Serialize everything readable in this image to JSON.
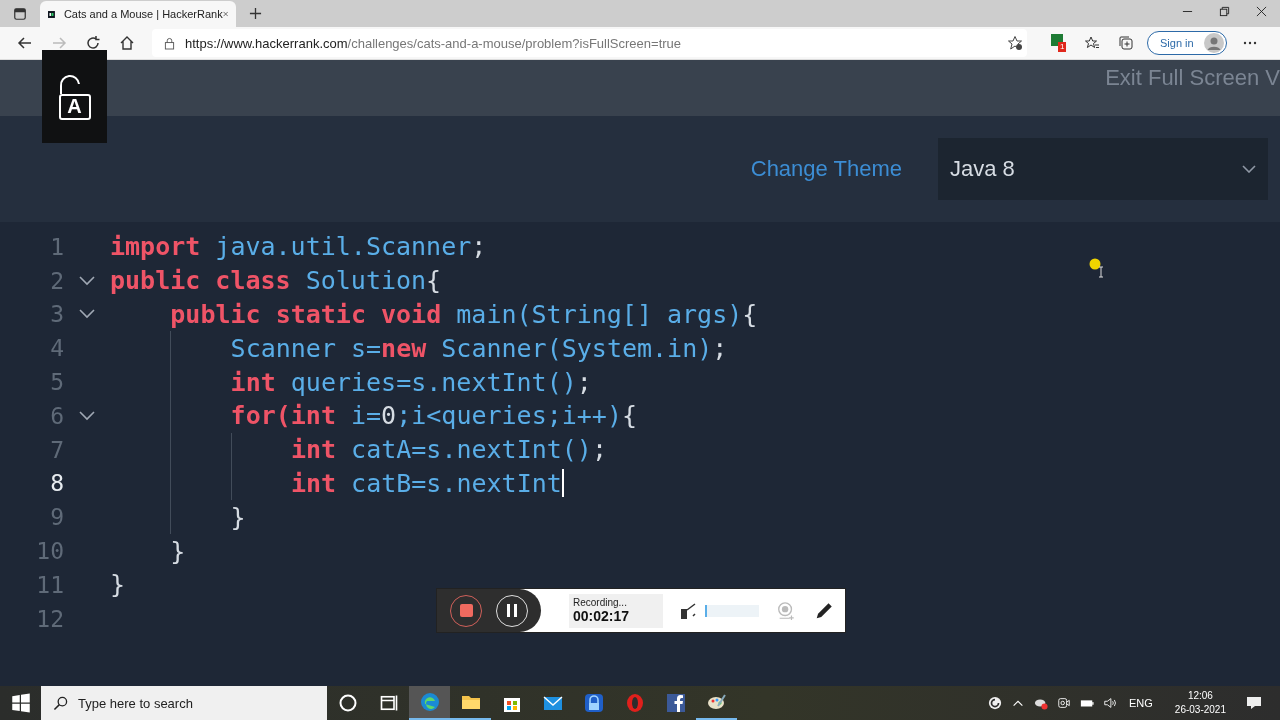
{
  "browser": {
    "tab": {
      "title": "Cats and a Mouse | HackerRank",
      "selected": true
    },
    "url": {
      "host": "https://www.hackerrank.com",
      "path": "/challenges/cats-and-a-mouse/problem?isFullScreen=true"
    },
    "badge_count": "1",
    "sign_in": "Sign in"
  },
  "caps_lock_overlay": {
    "letter": "A"
  },
  "page": {
    "exit_full_screen": "Exit Full Screen V",
    "change_theme": "Change Theme",
    "language": "Java 8"
  },
  "editor": {
    "lines": [
      {
        "number": "1",
        "active": false,
        "tokens": [
          {
            "text": "import",
            "kind": "keyword"
          },
          {
            "text": " java.util.Scanner",
            "kind": "identifier"
          },
          {
            "text": ";",
            "kind": "punctuation"
          }
        ]
      },
      {
        "number": "2",
        "active": false,
        "fold": {
          "expanded": true
        },
        "tokens": [
          {
            "text": "public class",
            "kind": "keyword"
          },
          {
            "text": " Solution",
            "kind": "identifier"
          },
          {
            "text": "{",
            "kind": "punctuation"
          }
        ],
        "children": [
          {
            "number": "3",
            "active": false,
            "fold": {
              "expanded": true
            },
            "tokens": [
              {
                "text": "public static void",
                "kind": "keyword"
              },
              {
                "text": " main(String[] args)",
                "kind": "identifier"
              },
              {
                "text": "{",
                "kind": "punctuation"
              }
            ],
            "children": [
              {
                "number": "4",
                "active": false,
                "tokens": [
                  {
                    "text": "Scanner s=",
                    "kind": "identifier"
                  },
                  {
                    "text": "new",
                    "kind": "keyword"
                  },
                  {
                    "text": " Scanner(System.in)",
                    "kind": "identifier"
                  },
                  {
                    "text": ";",
                    "kind": "punctuation"
                  }
                ]
              },
              {
                "number": "5",
                "active": false,
                "tokens": [
                  {
                    "text": "int",
                    "kind": "keyword"
                  },
                  {
                    "text": " queries=s.nextInt()",
                    "kind": "identifier"
                  },
                  {
                    "text": ";",
                    "kind": "punctuation"
                  }
                ]
              },
              {
                "number": "6",
                "active": false,
                "fold": {
                  "expanded": true
                },
                "tokens": [
                  {
                    "text": "for(int",
                    "kind": "keyword"
                  },
                  {
                    "text": " i=",
                    "kind": "identifier"
                  },
                  {
                    "text": "0",
                    "kind": "number"
                  },
                  {
                    "text": ";i<queries;i++)",
                    "kind": "identifier"
                  },
                  {
                    "text": "{",
                    "kind": "punctuation"
                  }
                ],
                "children": [
                  {
                    "number": "7",
                    "active": false,
                    "tokens": [
                      {
                        "text": "int",
                        "kind": "keyword"
                      },
                      {
                        "text": " catA=s.nextInt()",
                        "kind": "identifier"
                      },
                      {
                        "text": ";",
                        "kind": "punctuation"
                      }
                    ]
                  },
                  {
                    "number": "8",
                    "active": true,
                    "tokens": [
                      {
                        "text": "int",
                        "kind": "keyword"
                      },
                      {
                        "text": " catB=s.nextInt",
                        "kind": "identifier"
                      }
                    ]
                  }
                ]
              },
              {
                "number": "9",
                "active": false,
                "tokens": [
                  {
                    "text": "}",
                    "kind": "punctuation"
                  }
                ]
              }
            ]
          },
          {
            "number": "10",
            "active": false,
            "tokens": [
              {
                "text": "}",
                "kind": "punctuation"
              }
            ]
          }
        ]
      },
      {
        "number": "11",
        "active": false,
        "tokens": [
          {
            "text": "}",
            "kind": "punctuation"
          }
        ]
      },
      {
        "number": "12",
        "active": false
      }
    ]
  },
  "recorder": {
    "status": "Recording...",
    "time": "00:02:17",
    "level": 0.02
  },
  "taskbar": {
    "search_placeholder": "Type here to search",
    "language": "ENG",
    "time": "12:06",
    "date": "26-03-2021"
  }
}
